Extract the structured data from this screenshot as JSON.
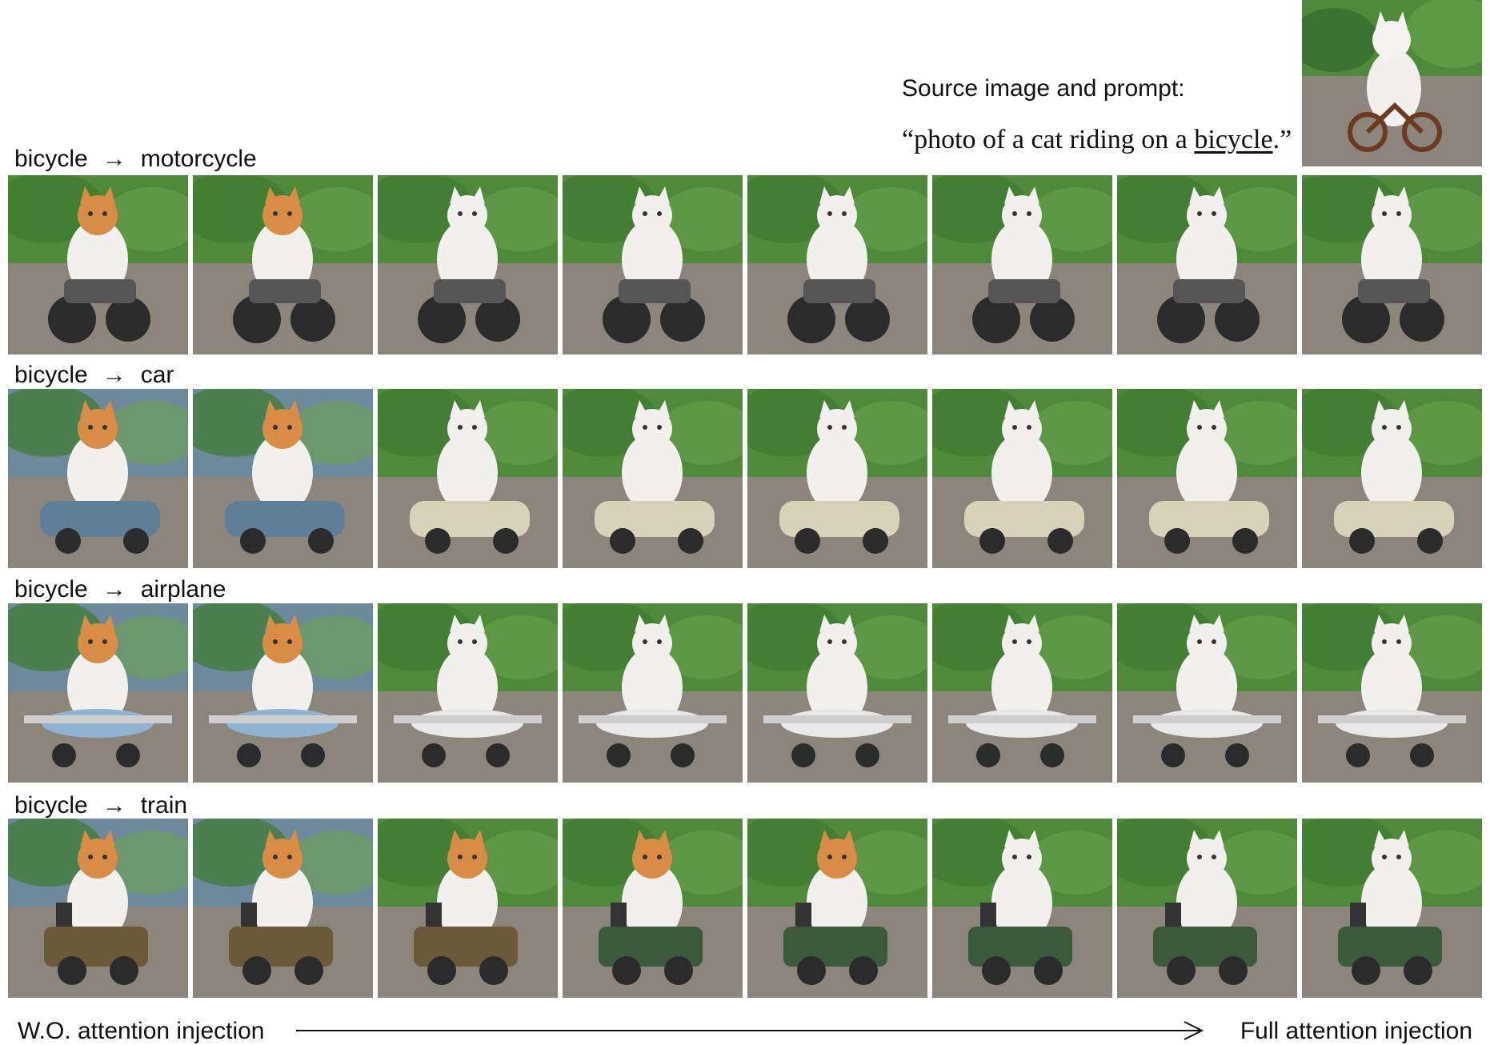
{
  "source": {
    "label": "Source image and prompt:",
    "prompt_open": "“photo of a cat riding on a ",
    "prompt_word": "bicycle",
    "prompt_close": ".”"
  },
  "rows": [
    {
      "from": "bicycle",
      "arrow": "→",
      "to": "motorcycle",
      "vehicle": "motorcycle"
    },
    {
      "from": "bicycle",
      "arrow": "→",
      "to": "car",
      "vehicle": "car"
    },
    {
      "from": "bicycle",
      "arrow": "→",
      "to": "airplane",
      "vehicle": "airplane"
    },
    {
      "from": "bicycle",
      "arrow": "→",
      "to": "train",
      "vehicle": "train"
    }
  ],
  "footer": {
    "left": "W.O. attention injection",
    "right": "Full attention injection"
  },
  "colors": {
    "foliage": "#4f8a3a",
    "road": "#8b857c",
    "cat_white": "#f1f0ec",
    "cat_orange": "#d98c45",
    "text": "#111111"
  }
}
